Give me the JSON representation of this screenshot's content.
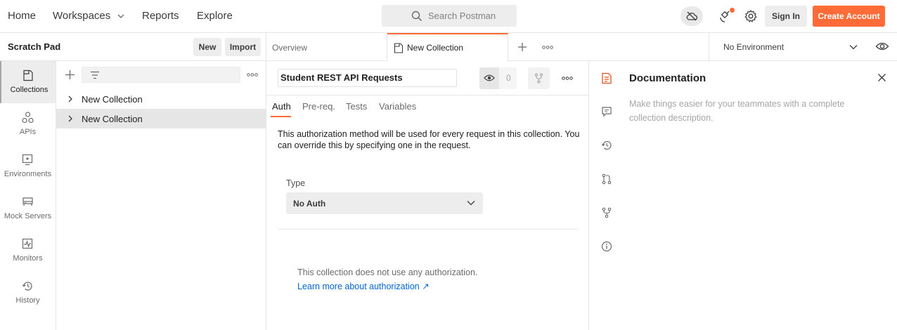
{
  "topbar": {
    "home": "Home",
    "workspaces": "Workspaces",
    "reports": "Reports",
    "explore": "Explore",
    "search_placeholder": "Search Postman",
    "sign_in": "Sign In",
    "create_account": "Create Account",
    "accent_color": "#ff6c37"
  },
  "scratch_pad": {
    "title": "Scratch Pad",
    "new_label": "New",
    "import_label": "Import"
  },
  "rail": {
    "items": [
      {
        "label": "Collections",
        "icon": "collections-icon",
        "active": true
      },
      {
        "label": "APIs",
        "icon": "apis-icon",
        "active": false
      },
      {
        "label": "Environments",
        "icon": "environments-icon",
        "active": false
      },
      {
        "label": "Mock Servers",
        "icon": "mock-servers-icon",
        "active": false
      },
      {
        "label": "Monitors",
        "icon": "monitors-icon",
        "active": false
      },
      {
        "label": "History",
        "icon": "history-icon",
        "active": false
      }
    ]
  },
  "collections": {
    "items": [
      {
        "label": "New Collection",
        "selected": false
      },
      {
        "label": "New Collection",
        "selected": true
      }
    ]
  },
  "tabs": {
    "overview": "Overview",
    "active": "New Collection",
    "environment": "No Environment"
  },
  "editor": {
    "collection_name": "Student REST API Requests",
    "watch_count": "0",
    "subtabs": [
      "Auth",
      "Pre-req.",
      "Tests",
      "Variables"
    ],
    "active_subtab": "Auth",
    "auth_description": "This authorization method will be used for every request in this collection. You can override this by specifying one in the request.",
    "type_label": "Type",
    "type_value": "No Auth",
    "no_auth_text": "This collection does not use any authorization.",
    "learn_more": "Learn more about authorization ↗"
  },
  "documentation": {
    "title": "Documentation",
    "description": "Make things easier for your teammates with a complete collection description."
  }
}
